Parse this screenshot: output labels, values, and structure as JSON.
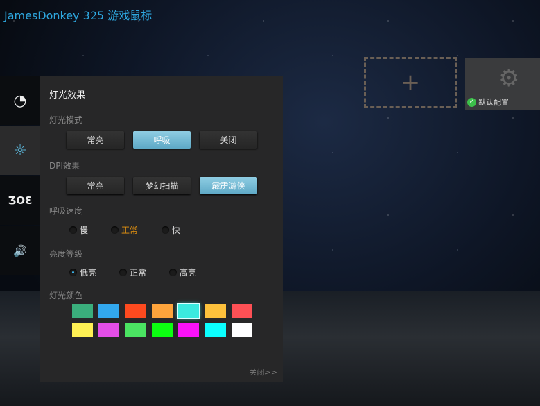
{
  "app": {
    "title": "JamesDonkey 325 游戏鼠标"
  },
  "sidebar": [
    {
      "icon": "speedometer-icon",
      "glyph": "◔"
    },
    {
      "icon": "sun-icon",
      "glyph": "☼"
    },
    {
      "icon": "dpi-icon",
      "glyph": "ƷOƐ"
    },
    {
      "icon": "speaker-icon",
      "glyph": "🔊"
    }
  ],
  "panel": {
    "title": "灯光效果",
    "light_mode": {
      "label": "灯光模式",
      "options": [
        "常亮",
        "呼吸",
        "关闭"
      ],
      "selected": "呼吸"
    },
    "dpi_effect": {
      "label": "DPI效果",
      "options": [
        "常亮",
        "梦幻扫描",
        "霹雳游侠"
      ],
      "selected": "霹雳游侠"
    },
    "breath_speed": {
      "label": "呼吸速度",
      "options": [
        "慢",
        "正常",
        "快"
      ],
      "selected": "正常"
    },
    "brightness": {
      "label": "亮度等级",
      "options": [
        "低亮",
        "正常",
        "高亮"
      ],
      "selected": "低亮"
    },
    "colors": {
      "label": "灯光颜色",
      "swatches": [
        "#3aae7c",
        "#32a8ee",
        "#fd4a1f",
        "#fea43c",
        "#3aeadf",
        "#fec13c",
        "#fe5055",
        "#fef054",
        "#e44ee8",
        "#4be462",
        "#0cff11",
        "#fa11f9",
        "#0bfffe",
        "#ffffff"
      ],
      "selected": "#3aeadf"
    },
    "close_label": "关闭>>"
  },
  "profiles": {
    "add": "+",
    "default_name": "默认配置"
  }
}
